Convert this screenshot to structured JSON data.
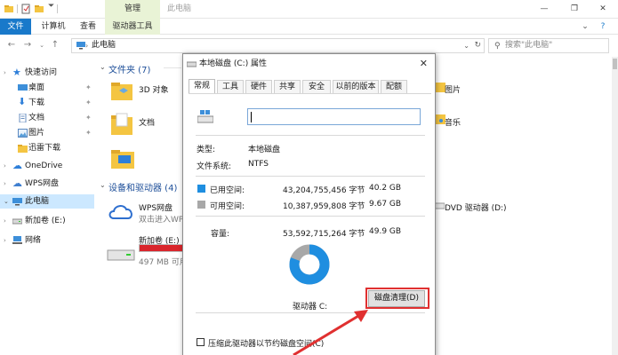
{
  "explorer": {
    "window_title": "此电脑",
    "ribbon": {
      "context_group": "管理",
      "tabs": [
        "文件",
        "计算机",
        "查看",
        "驱动器工具"
      ]
    },
    "address": {
      "path": "此电脑",
      "search_placeholder": "搜索\"此电脑\""
    },
    "sidebar": {
      "items": [
        {
          "label": "快速访问"
        },
        {
          "label": "桌面"
        },
        {
          "label": "下载"
        },
        {
          "label": "文档"
        },
        {
          "label": "图片"
        },
        {
          "label": "迅雷下载"
        },
        {
          "label": "OneDrive"
        },
        {
          "label": "WPS网盘"
        },
        {
          "label": "此电脑"
        },
        {
          "label": "新加卷 (E:)"
        },
        {
          "label": "网络"
        }
      ]
    },
    "content": {
      "folders_header": "文件夹 (7)",
      "folders": [
        "3D 对象",
        "文档",
        "图片",
        "音乐"
      ],
      "devices_header": "设备和驱动器 (4)",
      "wps": {
        "name": "WPS网盘",
        "sub": "双击进入WPS"
      },
      "vol_e": {
        "name": "新加卷 (E:)",
        "free": "497 MB 可用"
      },
      "dvd": "DVD 驱动器 (D:)"
    }
  },
  "dialog": {
    "title": "本地磁盘 (C:) 属性",
    "tabs": [
      "常规",
      "工具",
      "硬件",
      "共享",
      "安全",
      "以前的版本",
      "配额"
    ],
    "type_label": "类型:",
    "type_value": "本地磁盘",
    "fs_label": "文件系统:",
    "fs_value": "NTFS",
    "used_label": "已用空间:",
    "used_bytes": "43,204,755,456 字节",
    "used_gb": "40.2 GB",
    "free_label": "可用空间:",
    "free_bytes": "10,387,959,808 字节",
    "free_gb": "9.67 GB",
    "cap_label": "容量:",
    "cap_bytes": "53,592,715,264 字节",
    "cap_gb": "49.9 GB",
    "drive_label": "驱动器 C:",
    "cleanup_button": "磁盘清理(D)",
    "compress_option": "压缩此驱动器以节约磁盘空间(C)",
    "used_fraction": 0.806
  },
  "colors": {
    "used": "#1f8ee0",
    "free": "#a8a8a8",
    "accent": "#1979ca",
    "highlight": "#e03030"
  }
}
